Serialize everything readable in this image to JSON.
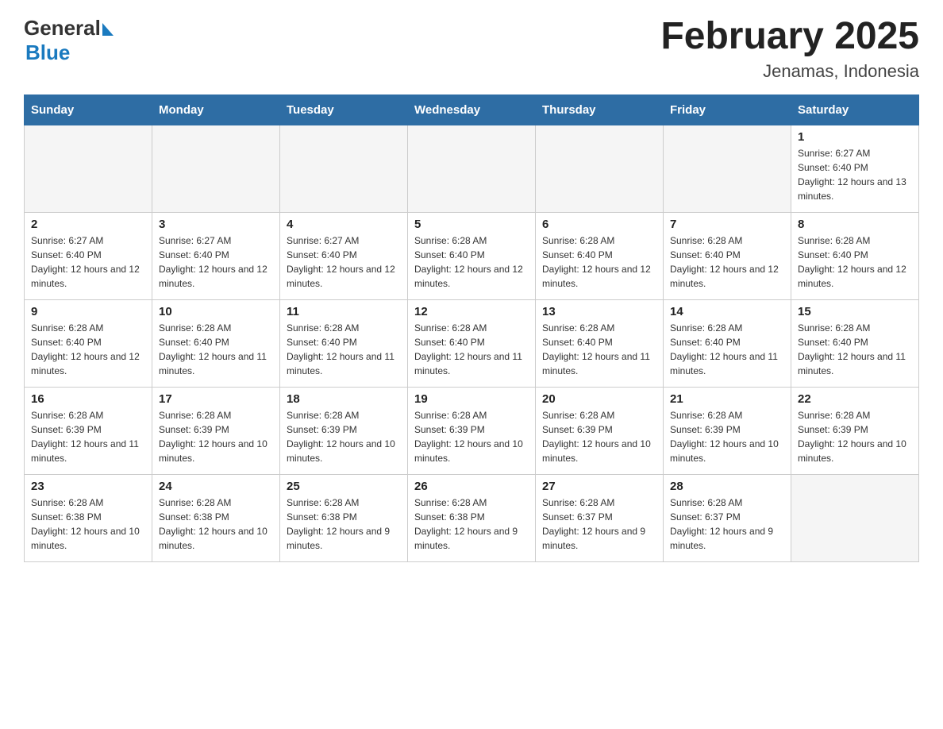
{
  "header": {
    "title": "February 2025",
    "location": "Jenamas, Indonesia",
    "logo_general": "General",
    "logo_blue": "Blue"
  },
  "weekdays": [
    "Sunday",
    "Monday",
    "Tuesday",
    "Wednesday",
    "Thursday",
    "Friday",
    "Saturday"
  ],
  "weeks": [
    [
      {
        "day": "",
        "sunrise": "",
        "sunset": "",
        "daylight": "",
        "empty": true
      },
      {
        "day": "",
        "sunrise": "",
        "sunset": "",
        "daylight": "",
        "empty": true
      },
      {
        "day": "",
        "sunrise": "",
        "sunset": "",
        "daylight": "",
        "empty": true
      },
      {
        "day": "",
        "sunrise": "",
        "sunset": "",
        "daylight": "",
        "empty": true
      },
      {
        "day": "",
        "sunrise": "",
        "sunset": "",
        "daylight": "",
        "empty": true
      },
      {
        "day": "",
        "sunrise": "",
        "sunset": "",
        "daylight": "",
        "empty": true
      },
      {
        "day": "1",
        "sunrise": "Sunrise: 6:27 AM",
        "sunset": "Sunset: 6:40 PM",
        "daylight": "Daylight: 12 hours and 13 minutes.",
        "empty": false
      }
    ],
    [
      {
        "day": "2",
        "sunrise": "Sunrise: 6:27 AM",
        "sunset": "Sunset: 6:40 PM",
        "daylight": "Daylight: 12 hours and 12 minutes.",
        "empty": false
      },
      {
        "day": "3",
        "sunrise": "Sunrise: 6:27 AM",
        "sunset": "Sunset: 6:40 PM",
        "daylight": "Daylight: 12 hours and 12 minutes.",
        "empty": false
      },
      {
        "day": "4",
        "sunrise": "Sunrise: 6:27 AM",
        "sunset": "Sunset: 6:40 PM",
        "daylight": "Daylight: 12 hours and 12 minutes.",
        "empty": false
      },
      {
        "day": "5",
        "sunrise": "Sunrise: 6:28 AM",
        "sunset": "Sunset: 6:40 PM",
        "daylight": "Daylight: 12 hours and 12 minutes.",
        "empty": false
      },
      {
        "day": "6",
        "sunrise": "Sunrise: 6:28 AM",
        "sunset": "Sunset: 6:40 PM",
        "daylight": "Daylight: 12 hours and 12 minutes.",
        "empty": false
      },
      {
        "day": "7",
        "sunrise": "Sunrise: 6:28 AM",
        "sunset": "Sunset: 6:40 PM",
        "daylight": "Daylight: 12 hours and 12 minutes.",
        "empty": false
      },
      {
        "day": "8",
        "sunrise": "Sunrise: 6:28 AM",
        "sunset": "Sunset: 6:40 PM",
        "daylight": "Daylight: 12 hours and 12 minutes.",
        "empty": false
      }
    ],
    [
      {
        "day": "9",
        "sunrise": "Sunrise: 6:28 AM",
        "sunset": "Sunset: 6:40 PM",
        "daylight": "Daylight: 12 hours and 12 minutes.",
        "empty": false
      },
      {
        "day": "10",
        "sunrise": "Sunrise: 6:28 AM",
        "sunset": "Sunset: 6:40 PM",
        "daylight": "Daylight: 12 hours and 11 minutes.",
        "empty": false
      },
      {
        "day": "11",
        "sunrise": "Sunrise: 6:28 AM",
        "sunset": "Sunset: 6:40 PM",
        "daylight": "Daylight: 12 hours and 11 minutes.",
        "empty": false
      },
      {
        "day": "12",
        "sunrise": "Sunrise: 6:28 AM",
        "sunset": "Sunset: 6:40 PM",
        "daylight": "Daylight: 12 hours and 11 minutes.",
        "empty": false
      },
      {
        "day": "13",
        "sunrise": "Sunrise: 6:28 AM",
        "sunset": "Sunset: 6:40 PM",
        "daylight": "Daylight: 12 hours and 11 minutes.",
        "empty": false
      },
      {
        "day": "14",
        "sunrise": "Sunrise: 6:28 AM",
        "sunset": "Sunset: 6:40 PM",
        "daylight": "Daylight: 12 hours and 11 minutes.",
        "empty": false
      },
      {
        "day": "15",
        "sunrise": "Sunrise: 6:28 AM",
        "sunset": "Sunset: 6:40 PM",
        "daylight": "Daylight: 12 hours and 11 minutes.",
        "empty": false
      }
    ],
    [
      {
        "day": "16",
        "sunrise": "Sunrise: 6:28 AM",
        "sunset": "Sunset: 6:39 PM",
        "daylight": "Daylight: 12 hours and 11 minutes.",
        "empty": false
      },
      {
        "day": "17",
        "sunrise": "Sunrise: 6:28 AM",
        "sunset": "Sunset: 6:39 PM",
        "daylight": "Daylight: 12 hours and 10 minutes.",
        "empty": false
      },
      {
        "day": "18",
        "sunrise": "Sunrise: 6:28 AM",
        "sunset": "Sunset: 6:39 PM",
        "daylight": "Daylight: 12 hours and 10 minutes.",
        "empty": false
      },
      {
        "day": "19",
        "sunrise": "Sunrise: 6:28 AM",
        "sunset": "Sunset: 6:39 PM",
        "daylight": "Daylight: 12 hours and 10 minutes.",
        "empty": false
      },
      {
        "day": "20",
        "sunrise": "Sunrise: 6:28 AM",
        "sunset": "Sunset: 6:39 PM",
        "daylight": "Daylight: 12 hours and 10 minutes.",
        "empty": false
      },
      {
        "day": "21",
        "sunrise": "Sunrise: 6:28 AM",
        "sunset": "Sunset: 6:39 PM",
        "daylight": "Daylight: 12 hours and 10 minutes.",
        "empty": false
      },
      {
        "day": "22",
        "sunrise": "Sunrise: 6:28 AM",
        "sunset": "Sunset: 6:39 PM",
        "daylight": "Daylight: 12 hours and 10 minutes.",
        "empty": false
      }
    ],
    [
      {
        "day": "23",
        "sunrise": "Sunrise: 6:28 AM",
        "sunset": "Sunset: 6:38 PM",
        "daylight": "Daylight: 12 hours and 10 minutes.",
        "empty": false
      },
      {
        "day": "24",
        "sunrise": "Sunrise: 6:28 AM",
        "sunset": "Sunset: 6:38 PM",
        "daylight": "Daylight: 12 hours and 10 minutes.",
        "empty": false
      },
      {
        "day": "25",
        "sunrise": "Sunrise: 6:28 AM",
        "sunset": "Sunset: 6:38 PM",
        "daylight": "Daylight: 12 hours and 9 minutes.",
        "empty": false
      },
      {
        "day": "26",
        "sunrise": "Sunrise: 6:28 AM",
        "sunset": "Sunset: 6:38 PM",
        "daylight": "Daylight: 12 hours and 9 minutes.",
        "empty": false
      },
      {
        "day": "27",
        "sunrise": "Sunrise: 6:28 AM",
        "sunset": "Sunset: 6:37 PM",
        "daylight": "Daylight: 12 hours and 9 minutes.",
        "empty": false
      },
      {
        "day": "28",
        "sunrise": "Sunrise: 6:28 AM",
        "sunset": "Sunset: 6:37 PM",
        "daylight": "Daylight: 12 hours and 9 minutes.",
        "empty": false
      },
      {
        "day": "",
        "sunrise": "",
        "sunset": "",
        "daylight": "",
        "empty": true
      }
    ]
  ]
}
